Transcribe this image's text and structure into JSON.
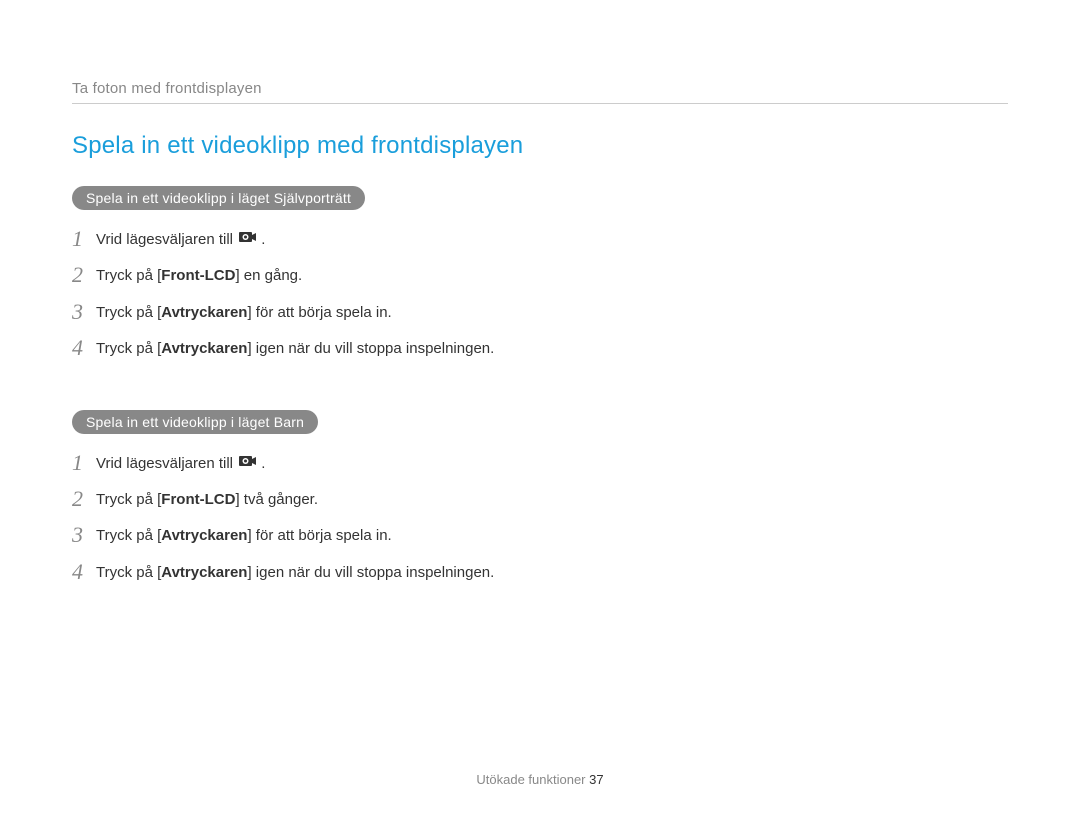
{
  "breadcrumb": "Ta foton med frontdisplayen",
  "title": "Spela in ett videoklipp med frontdisplayen",
  "section1": {
    "heading": "Spela in ett videoklipp i läget Självporträtt",
    "steps": [
      {
        "num": "1",
        "pre": "Vrid lägesväljaren till ",
        "icon": "video-icon",
        "post": "."
      },
      {
        "num": "2",
        "pre": "Tryck på [",
        "bold": "Front-LCD",
        "post": "] en gång."
      },
      {
        "num": "3",
        "pre": "Tryck på [",
        "bold": "Avtryckaren",
        "post": "] för att börja spela in."
      },
      {
        "num": "4",
        "pre": "Tryck på [",
        "bold": "Avtryckaren",
        "post": "] igen när du vill stoppa inspelningen."
      }
    ]
  },
  "section2": {
    "heading": "Spela in ett videoklipp i läget Barn",
    "steps": [
      {
        "num": "1",
        "pre": "Vrid lägesväljaren till ",
        "icon": "video-icon",
        "post": "."
      },
      {
        "num": "2",
        "pre": "Tryck på [",
        "bold": "Front-LCD",
        "post": "] två gånger."
      },
      {
        "num": "3",
        "pre": "Tryck på [",
        "bold": "Avtryckaren",
        "post": "] för att börja spela in."
      },
      {
        "num": "4",
        "pre": "Tryck på [",
        "bold": "Avtryckaren",
        "post": "] igen när du vill stoppa inspelningen."
      }
    ]
  },
  "footer": {
    "label": "Utökade funktioner",
    "page": "37"
  }
}
